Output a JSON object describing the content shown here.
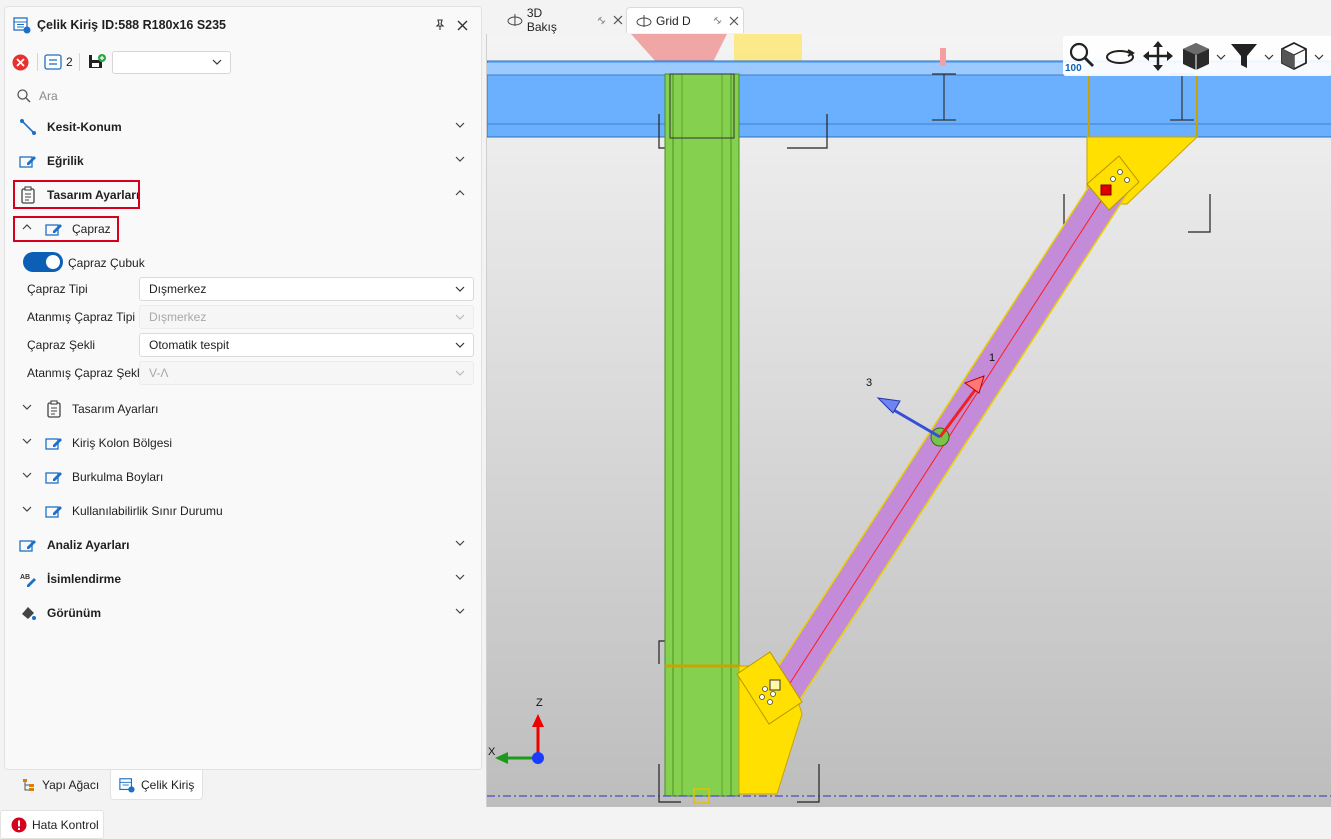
{
  "panel": {
    "title": "Çelik Kiriş ID:588 R180x16 S235",
    "pin_icon": "pin-icon",
    "close_icon": "close-icon"
  },
  "toolbar": {
    "count": "2",
    "combo_value": ""
  },
  "search": {
    "placeholder": "Ara"
  },
  "sections": {
    "kesit_konum": "Kesit-Konum",
    "egrilik": "Eğrilik",
    "tasarim_ayarlari": "Tasarım Ayarları",
    "analiz_ayarlari": "Analiz Ayarları",
    "isimlendirme": "İsimlendirme",
    "gorunum": "Görünüm"
  },
  "capraz": {
    "header": "Çapraz",
    "toggle_label": "Çapraz Çubuk",
    "toggle_on": true,
    "props": [
      {
        "label": "Çapraz Tipi",
        "value": "Dışmerkez",
        "disabled": false
      },
      {
        "label": "Atanmış Çapraz Tipi",
        "value": "Dışmerkez",
        "disabled": true
      },
      {
        "label": "Çapraz Şekli",
        "value": "Otomatik tespit",
        "disabled": false
      },
      {
        "label": "Atanmış Çapraz Şekl",
        "value": "V-Λ",
        "disabled": true
      }
    ]
  },
  "subsections": {
    "tasarim_ayarlari": "Tasarım Ayarları",
    "kiris_kolon": "Kiriş Kolon Bölgesi",
    "burkulma": "Burkulma Boyları",
    "kullanilabilirlik": "Kullanılabilirlik Sınır Durumu"
  },
  "bottom_tabs": {
    "yapi_agaci": "Yapı Ağacı",
    "celik_kiris": "Çelik Kiriş"
  },
  "status": {
    "hata_kontrol": "Hata Kontrol"
  },
  "doc_tabs": {
    "tab1": "3D Bakış",
    "tab2": "Grid D"
  },
  "viewport": {
    "zoom_value": "100",
    "axis_labels": {
      "z": "Z",
      "x": "X"
    },
    "member_axis_labels": {
      "axis1": "1",
      "axis3": "3"
    }
  },
  "colors": {
    "accent": "#0c5fb5",
    "highlight": "#d6001c",
    "column": "#85d04f",
    "beam": "#6bb0ff",
    "brace": "#c48bd9",
    "plate": "#ffe000"
  }
}
